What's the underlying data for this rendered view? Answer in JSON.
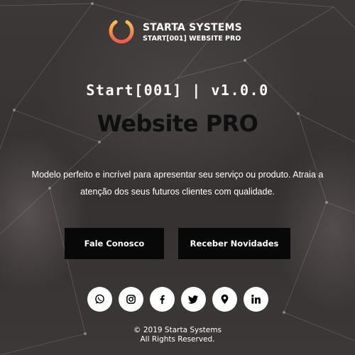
{
  "brand": {
    "name": "STARTA SYSTEMS",
    "tagline": "START[001] WEBSITE PRO",
    "logo_icon": "power-icon",
    "logo_colors": [
      "#f7c24a",
      "#f05a4a"
    ]
  },
  "hero": {
    "version": "Start[001] | v1.0.0",
    "headline": "Website PRO",
    "description": "Modelo perfeito e incrível para apresentar seu serviço ou produto. Atraia a atenção dos seus futuros clientes com qualidade."
  },
  "buttons": {
    "contact": "Fale Conosco",
    "newsletter": "Receber Novidades"
  },
  "socials": [
    {
      "icon": "whatsapp-icon"
    },
    {
      "icon": "instagram-icon"
    },
    {
      "icon": "facebook-icon"
    },
    {
      "icon": "twitter-icon"
    },
    {
      "icon": "location-pin-icon"
    },
    {
      "icon": "linkedin-icon"
    }
  ],
  "footer": {
    "copyright": "© 2019 Starta Systems",
    "rights": "All Rights Reserved."
  },
  "colors": {
    "background": "#3a3636",
    "button_bg": "#080808",
    "headline": "#0f0f0f",
    "text": "#ffffff"
  }
}
